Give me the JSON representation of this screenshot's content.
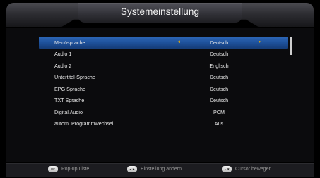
{
  "header": {
    "title": "Systemeinstellung"
  },
  "menu": {
    "rows": [
      {
        "label": "Menüsprache",
        "value": "Deutsch",
        "selected": true
      },
      {
        "label": "Audio 1",
        "value": "Deutsch",
        "selected": false
      },
      {
        "label": "Audio 2",
        "value": "Englisch",
        "selected": false
      },
      {
        "label": "Untertitel-Sprache",
        "value": "Deutsch",
        "selected": false
      },
      {
        "label": "EPG Sprache",
        "value": "Deutsch",
        "selected": false
      },
      {
        "label": "TXT Sprache",
        "value": "Deutsch",
        "selected": false
      },
      {
        "label": "Digital Audio",
        "value": "PCM",
        "selected": false
      },
      {
        "label": "autom. Programmwechsel",
        "value": "Aus",
        "selected": false
      }
    ],
    "arrow_left": "◄",
    "arrow_right": "►"
  },
  "footer": {
    "ok_key": "OK",
    "ok_label": "Pop-up Liste",
    "lr_key": "◄►",
    "lr_label": "Einstellung ändern",
    "ud_key": "▲▼",
    "ud_label": "Cursor bewegen"
  },
  "colors": {
    "selection": "#1d4f98",
    "arrow": "#f0b000",
    "background": "#000000"
  }
}
